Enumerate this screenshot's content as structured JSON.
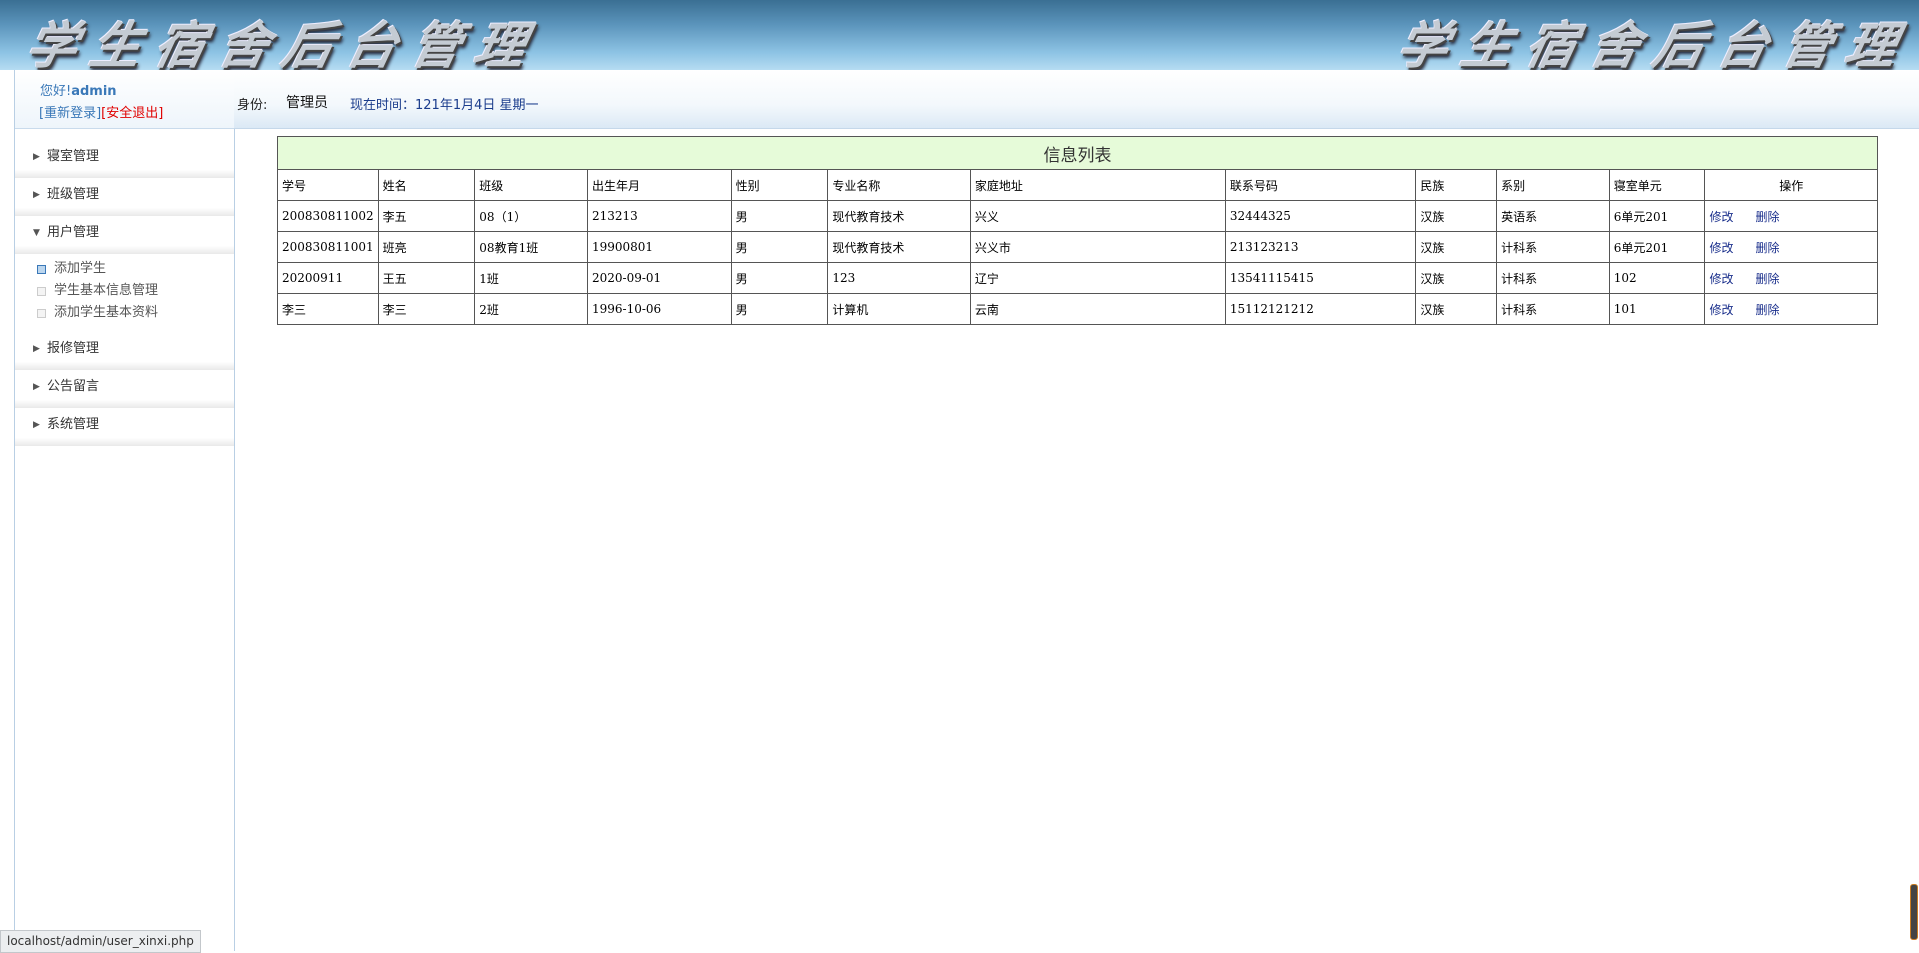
{
  "banner": {
    "title": "学生宿舍后台管理"
  },
  "sidebar": {
    "greeting_prefix": "您好!",
    "username": "admin",
    "relogin": "[重新登录]",
    "logout": "[安全退出]",
    "menu": [
      {
        "label": "寝室管理"
      },
      {
        "label": "班级管理"
      },
      {
        "label": "用户管理"
      },
      {
        "label": "报修管理"
      },
      {
        "label": "公告留言"
      },
      {
        "label": "系统管理"
      }
    ],
    "submenu": [
      {
        "label": "添加学生"
      },
      {
        "label": "学生基本信息管理"
      },
      {
        "label": "添加学生基本资料"
      }
    ]
  },
  "topbar": {
    "identity_label": "身份:",
    "role": "管理员",
    "time": "现在时间：121年1月4日 星期一"
  },
  "table": {
    "caption": "信息列表",
    "headers": [
      "学号",
      "姓名",
      "班级",
      "出生年月",
      "性别",
      "专业名称",
      "家庭地址",
      "联系号码",
      "民族",
      "系别",
      "寝室单元",
      "操作"
    ],
    "rows": [
      [
        "200830811002",
        "李五",
        "08（1）",
        "213213",
        "男",
        "现代教育技术",
        "兴义",
        "32444325",
        "汉族",
        "英语系",
        "6单元201"
      ],
      [
        "200830811001",
        "班亮",
        "08教育1班",
        "19900801",
        "男",
        "现代教育技术",
        "兴义市",
        "213123213",
        "汉族",
        "计科系",
        "6单元201"
      ],
      [
        "20200911",
        "王五",
        "1班",
        "2020-09-01",
        "男",
        "123",
        "辽宁",
        "13541115415",
        "汉族",
        "计科系",
        "102"
      ],
      [
        "李三",
        "李三",
        "2班",
        "1996-10-06",
        "男",
        "计算机",
        "云南",
        "15112121212",
        "汉族",
        "计科系",
        "101"
      ]
    ],
    "edit_label": "修改",
    "delete_label": "删除"
  },
  "statusbar": {
    "url": "localhost/admin/user_xinxi.php"
  }
}
